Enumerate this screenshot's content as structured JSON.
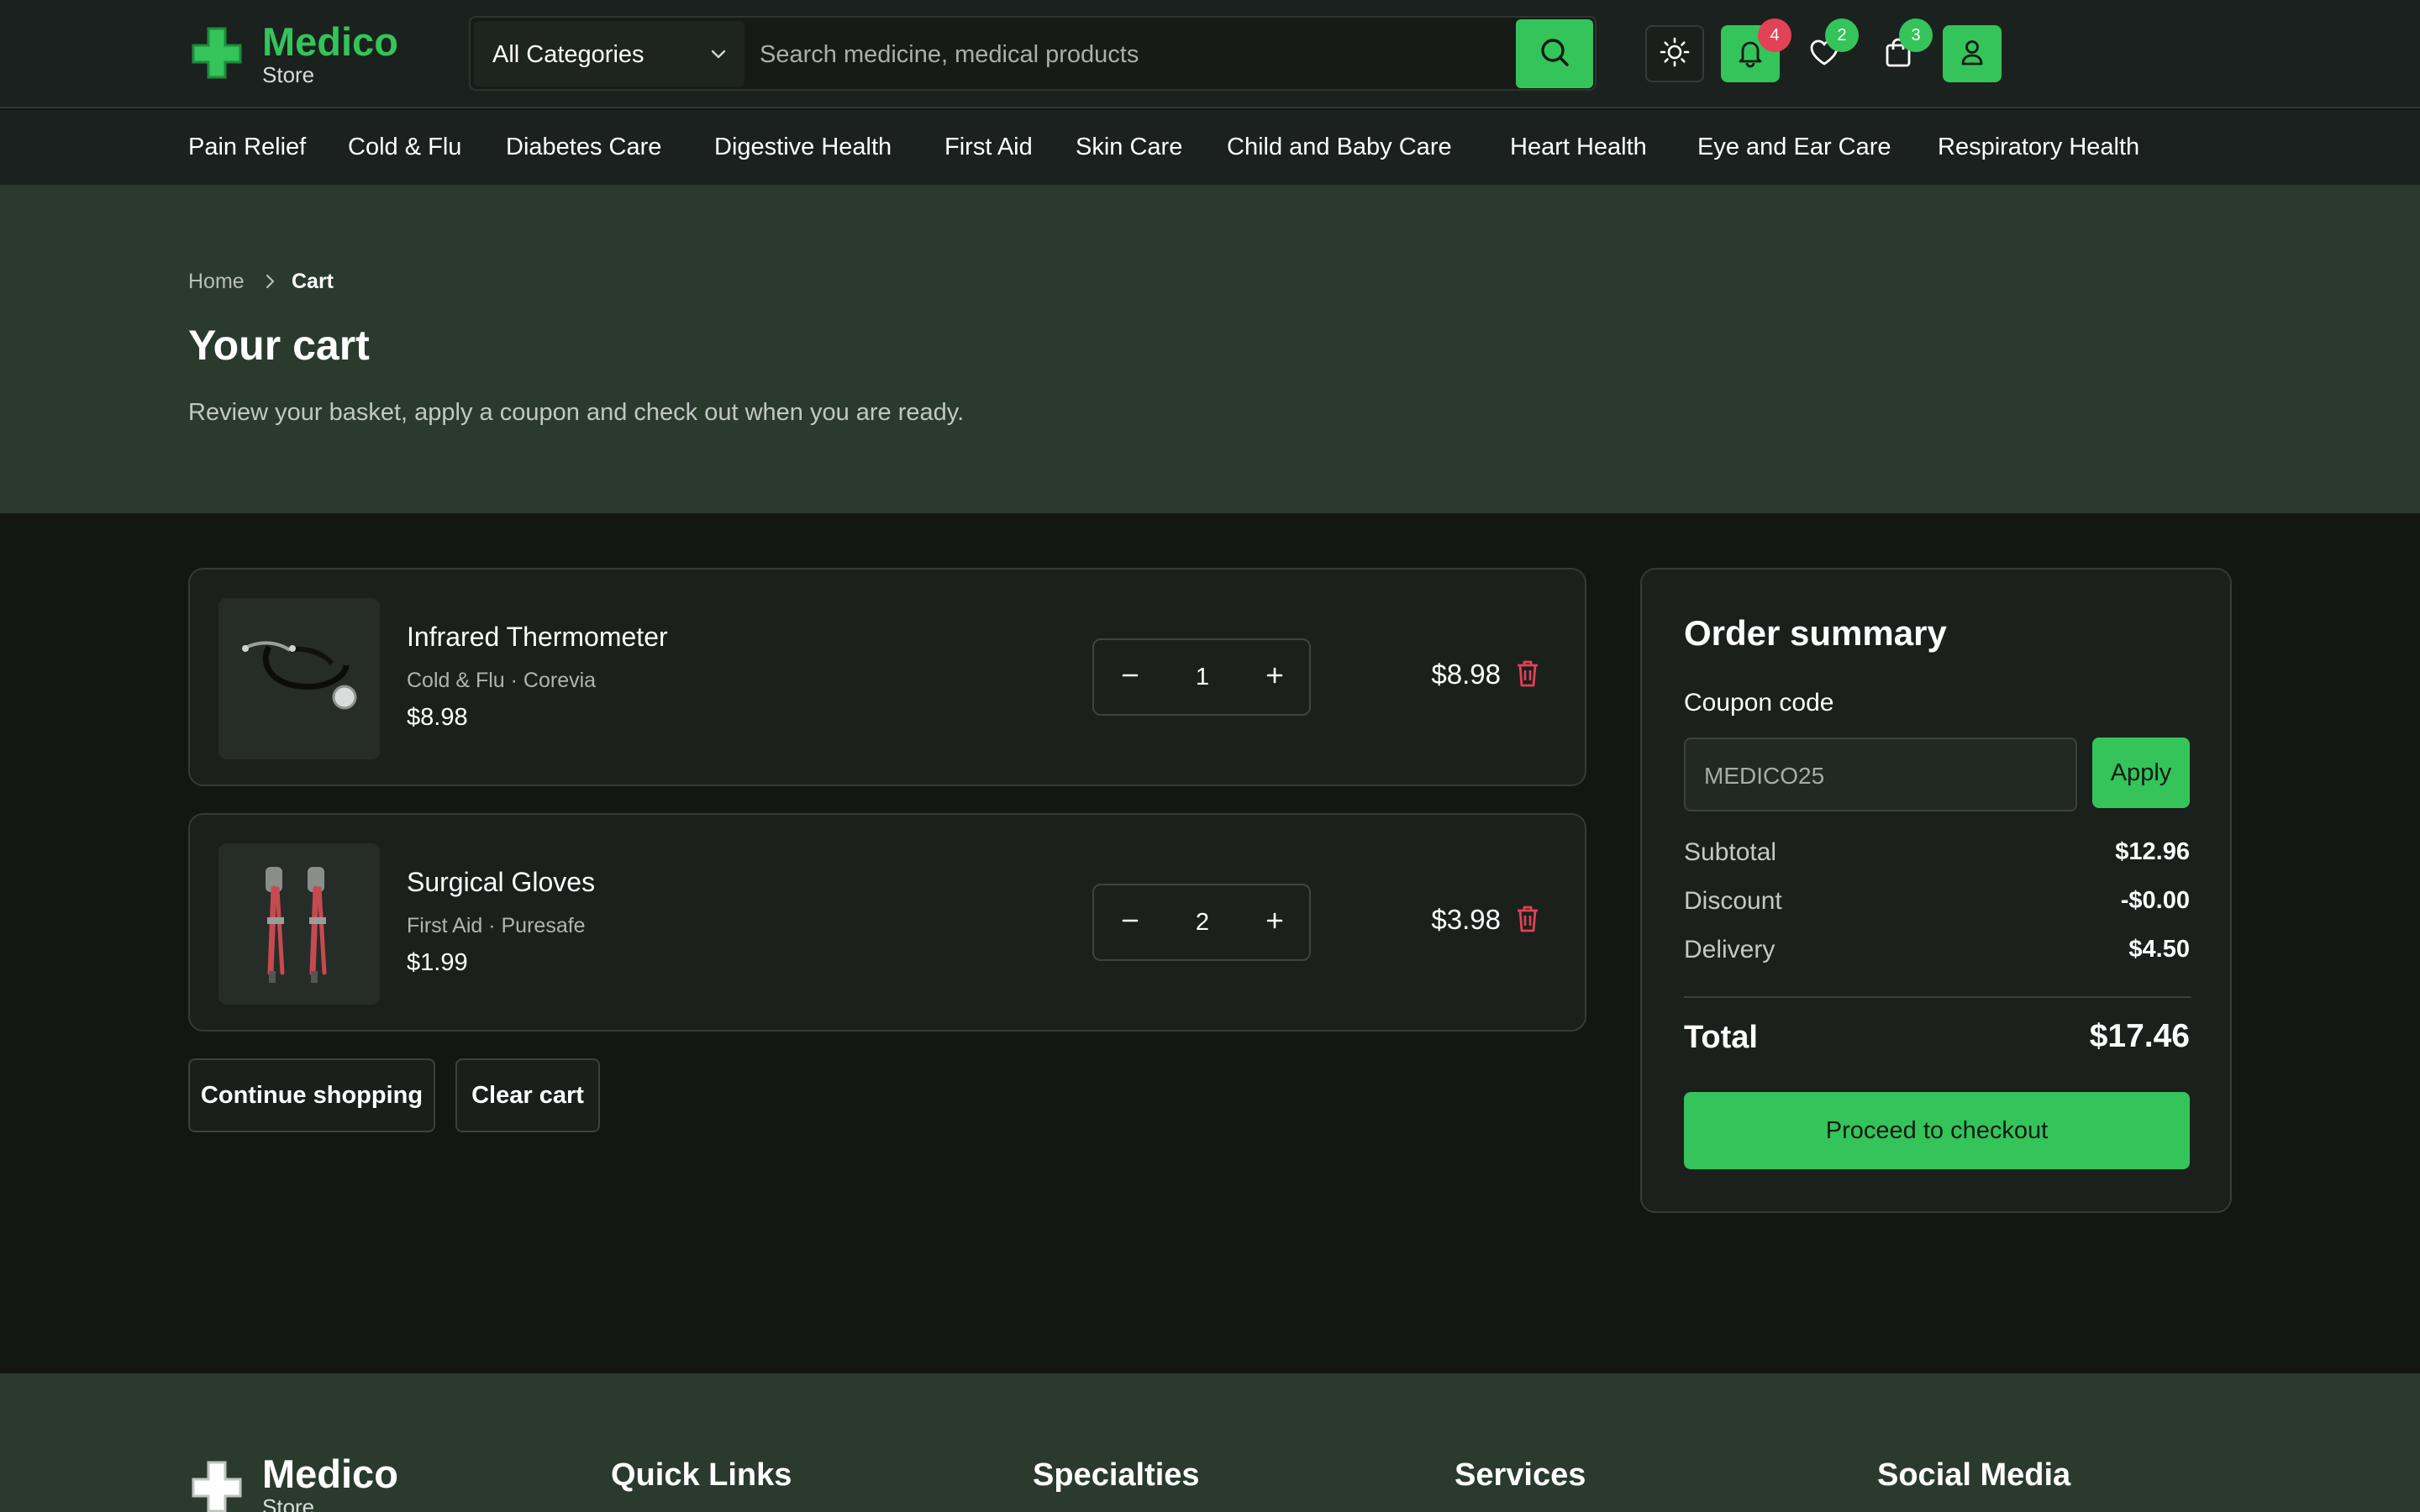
{
  "brand": {
    "name": "Medico",
    "sub": "Store",
    "accent": "#34c45a"
  },
  "search": {
    "category": "All Categories",
    "placeholder": "Search medicine, medical products"
  },
  "header": {
    "notifications_count": "4",
    "wishlist_count": "2",
    "cart_count": "3"
  },
  "nav": [
    "Pain Relief",
    "Cold & Flu",
    "Diabetes Care",
    "Digestive Health",
    "First Aid",
    "Skin Care",
    "Child and Baby Care",
    "Heart Health",
    "Eye and Ear Care",
    "Respiratory Health"
  ],
  "breadcrumb": {
    "home": "Home",
    "current": "Cart"
  },
  "page": {
    "title": "Your cart",
    "description": "Review your basket, apply a coupon and check out when you are ready."
  },
  "cart": {
    "items": [
      {
        "name": "Infrared Thermometer",
        "meta": "Cold & Flu · Corevia",
        "unit_price": "$8.98",
        "qty": "1",
        "total": "$8.98"
      },
      {
        "name": "Surgical Gloves",
        "meta": "First Aid · Puresafe",
        "unit_price": "$1.99",
        "qty": "2",
        "total": "$3.98"
      }
    ],
    "continue_label": "Continue shopping",
    "clear_label": "Clear cart"
  },
  "summary": {
    "title": "Order summary",
    "coupon_label": "Coupon code",
    "coupon_value": "MEDICO25",
    "apply_label": "Apply",
    "subtotal_label": "Subtotal",
    "subtotal": "$12.96",
    "discount_label": "Discount",
    "discount": "-$0.00",
    "delivery_label": "Delivery",
    "delivery": "$4.50",
    "total_label": "Total",
    "total": "$17.46",
    "checkout_label": "Proceed to checkout"
  },
  "footer": {
    "brand": "Medico",
    "brand_sub": "Store",
    "columns": [
      "Quick Links",
      "Specialties",
      "Services",
      "Social Media"
    ]
  }
}
